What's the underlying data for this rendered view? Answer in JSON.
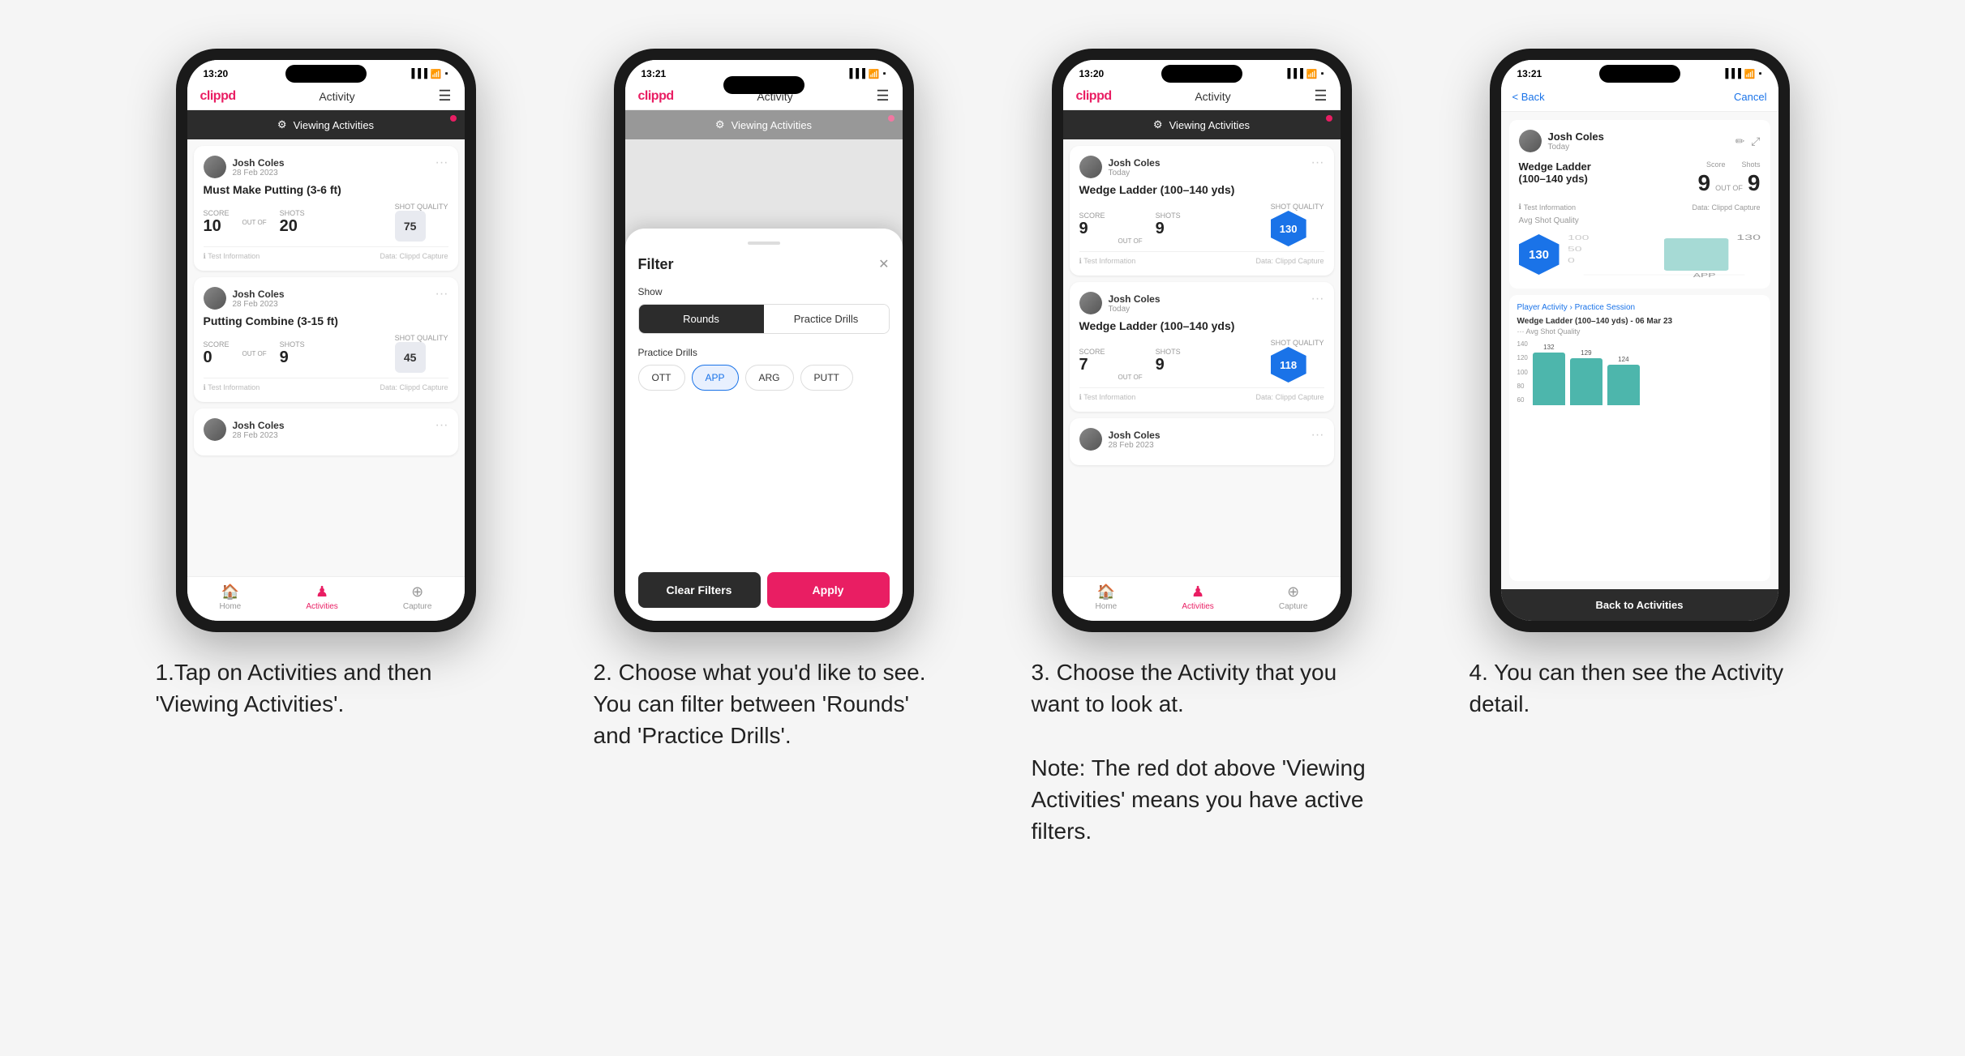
{
  "phone1": {
    "status_time": "13:20",
    "nav_logo": "clippd",
    "nav_title": "Activity",
    "banner_text": "Viewing Activities",
    "cards": [
      {
        "user_name": "Josh Coles",
        "user_date": "28 Feb 2023",
        "title": "Must Make Putting (3-6 ft)",
        "score_label": "Score",
        "shots_label": "Shots",
        "quality_label": "Shot Quality",
        "score": "10",
        "outof": "OUT OF",
        "shots": "20",
        "quality": "75",
        "footer_left": "Test Information",
        "footer_right": "Data: Clippd Capture"
      },
      {
        "user_name": "Josh Coles",
        "user_date": "28 Feb 2023",
        "title": "Putting Combine (3-15 ft)",
        "score_label": "Score",
        "shots_label": "Shots",
        "quality_label": "Shot Quality",
        "score": "0",
        "outof": "OUT OF",
        "shots": "9",
        "quality": "45",
        "footer_left": "Test Information",
        "footer_right": "Data: Clippd Capture"
      },
      {
        "user_name": "Josh Coles",
        "user_date": "28 Feb 2023",
        "title": "",
        "score": "",
        "shots": "",
        "quality": ""
      }
    ],
    "bottom_nav": [
      {
        "label": "Home",
        "icon": "🏠",
        "active": false
      },
      {
        "label": "Activities",
        "icon": "♟",
        "active": true
      },
      {
        "label": "Capture",
        "icon": "⊕",
        "active": false
      }
    ]
  },
  "phone2": {
    "status_time": "13:21",
    "nav_logo": "clippd",
    "nav_title": "Activity",
    "banner_text": "Viewing Activities",
    "filter_title": "Filter",
    "filter_show_label": "Show",
    "filter_rounds_label": "Rounds",
    "filter_drills_label": "Practice Drills",
    "filter_drills_section": "Practice Drills",
    "filter_chips": [
      "OTT",
      "APP",
      "ARG",
      "PUTT"
    ],
    "btn_clear": "Clear Filters",
    "btn_apply": "Apply"
  },
  "phone3": {
    "status_time": "13:20",
    "nav_logo": "clippd",
    "nav_title": "Activity",
    "banner_text": "Viewing Activities",
    "cards": [
      {
        "user_name": "Josh Coles",
        "user_date": "Today",
        "title": "Wedge Ladder (100–140 yds)",
        "score": "9",
        "outof": "OUT OF",
        "shots": "9",
        "quality": "130",
        "footer_left": "Test Information",
        "footer_right": "Data: Clippd Capture"
      },
      {
        "user_name": "Josh Coles",
        "user_date": "Today",
        "title": "Wedge Ladder (100–140 yds)",
        "score": "7",
        "outof": "OUT OF",
        "shots": "9",
        "quality": "118",
        "footer_left": "Test Information",
        "footer_right": "Data: Clippd Capture"
      },
      {
        "user_name": "Josh Coles",
        "user_date": "28 Feb 2023",
        "title": "",
        "score": "",
        "shots": "",
        "quality": ""
      }
    ],
    "bottom_nav": [
      {
        "label": "Home",
        "icon": "🏠",
        "active": false
      },
      {
        "label": "Activities",
        "icon": "♟",
        "active": true
      },
      {
        "label": "Capture",
        "icon": "⊕",
        "active": false
      }
    ]
  },
  "phone4": {
    "status_time": "13:21",
    "back_label": "< Back",
    "cancel_label": "Cancel",
    "user_name": "Josh Coles",
    "user_date": "Today",
    "drill_name": "Wedge Ladder\n(100–140 yds)",
    "score_label": "Score",
    "shots_label": "Shots",
    "score_value": "9",
    "outof": "OUT OF",
    "shots_value": "9",
    "info_text": "Test Information",
    "data_text": "Data: Clippd Capture",
    "avg_quality_label": "Avg Shot Quality",
    "quality_value": "130",
    "chart_label": "130",
    "practice_session": "Player Activity › Practice Session",
    "chart_title": "Wedge Ladder (100–140 yds) - 06 Mar 23",
    "chart_subtitle": "··· Avg Shot Quality",
    "bars": [
      {
        "value": 132,
        "label": ""
      },
      {
        "value": 129,
        "label": ""
      },
      {
        "value": 124,
        "label": ""
      }
    ],
    "back_btn": "Back to Activities"
  },
  "captions": [
    "1.Tap on Activities and then 'Viewing Activities'.",
    "2. Choose what you'd like to see. You can filter between 'Rounds' and 'Practice Drills'.",
    "3. Choose the Activity that you want to look at.\n\nNote: The red dot above 'Viewing Activities' means you have active filters.",
    "4. You can then see the Activity detail."
  ]
}
